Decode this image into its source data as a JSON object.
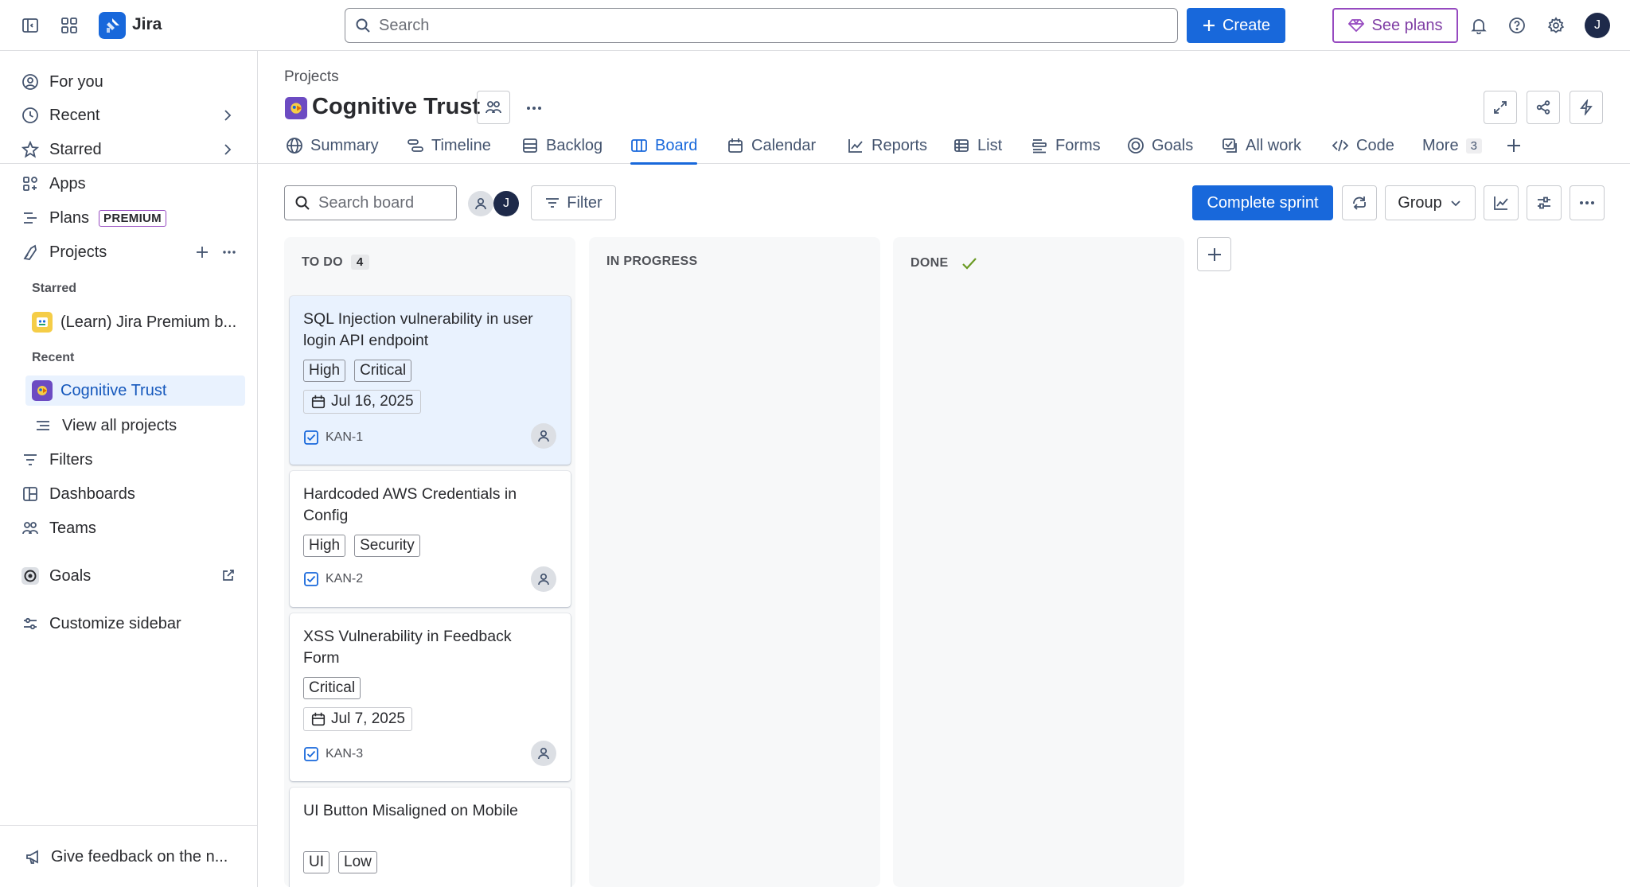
{
  "app": {
    "name": "Jira"
  },
  "topbar": {
    "search_placeholder": "Search",
    "create_label": "Create",
    "see_plans_label": "See plans",
    "user_initial": "J"
  },
  "sidebar": {
    "items": [
      {
        "label": "For you",
        "icon": "user-circle-icon"
      },
      {
        "label": "Recent",
        "icon": "clock-icon"
      },
      {
        "label": "Starred",
        "icon": "star-icon"
      },
      {
        "label": "Apps",
        "icon": "apps-icon"
      },
      {
        "label": "Plans",
        "icon": "plans-icon",
        "badge": "PREMIUM"
      },
      {
        "label": "Projects",
        "icon": "projects-icon"
      }
    ],
    "section_starred": "Starred",
    "starred_project": "(Learn) Jira Premium b...",
    "section_recent": "Recent",
    "recent_project": "Cognitive Trust",
    "view_all_projects": "View all projects",
    "bottom_items": [
      {
        "label": "Filters",
        "icon": "filter-icon"
      },
      {
        "label": "Dashboards",
        "icon": "dashboard-icon"
      },
      {
        "label": "Teams",
        "icon": "teams-icon"
      }
    ],
    "goals": "Goals",
    "customize": "Customize sidebar",
    "feedback": "Give feedback on the n..."
  },
  "header": {
    "breadcrumb": "Projects",
    "project_title": "Cognitive Trust"
  },
  "tabs": [
    {
      "label": "Summary",
      "icon": "globe-icon"
    },
    {
      "label": "Timeline",
      "icon": "timeline-icon"
    },
    {
      "label": "Backlog",
      "icon": "backlog-icon"
    },
    {
      "label": "Board",
      "icon": "board-icon",
      "active": true
    },
    {
      "label": "Calendar",
      "icon": "calendar-icon"
    },
    {
      "label": "Reports",
      "icon": "reports-icon"
    },
    {
      "label": "List",
      "icon": "list-icon"
    },
    {
      "label": "Forms",
      "icon": "forms-icon"
    },
    {
      "label": "Goals",
      "icon": "goal-icon"
    },
    {
      "label": "All work",
      "icon": "all-work-icon"
    },
    {
      "label": "Code",
      "icon": "code-icon"
    },
    {
      "label": "More",
      "icon": "more-icon",
      "count": "3"
    }
  ],
  "toolbar": {
    "search_placeholder": "Search board",
    "avatar_initial": "J",
    "filter_label": "Filter",
    "complete_sprint_label": "Complete sprint",
    "group_label": "Group"
  },
  "columns": [
    {
      "title": "TO DO",
      "count": "4"
    },
    {
      "title": "IN PROGRESS"
    },
    {
      "title": "DONE"
    }
  ],
  "cards": [
    {
      "title": "SQL Injection vulnerability in user login API endpoint",
      "labels": [
        "High",
        "Critical"
      ],
      "date": "Jul 16, 2025",
      "key": "KAN-1"
    },
    {
      "title": "Hardcoded AWS Credentials in Config",
      "labels": [
        "High",
        "Security"
      ],
      "key": "KAN-2"
    },
    {
      "title": "XSS Vulnerability in Feedback Form",
      "labels": [
        "Critical"
      ],
      "date": "Jul 7, 2025",
      "key": "KAN-3"
    },
    {
      "title": "UI Button Misaligned on Mobile",
      "labels": [
        "UI",
        "Low"
      ]
    }
  ],
  "colors": {
    "brand_blue": "#1868db",
    "premium_purple": "#964ac0",
    "done_green": "#6a9a23"
  }
}
